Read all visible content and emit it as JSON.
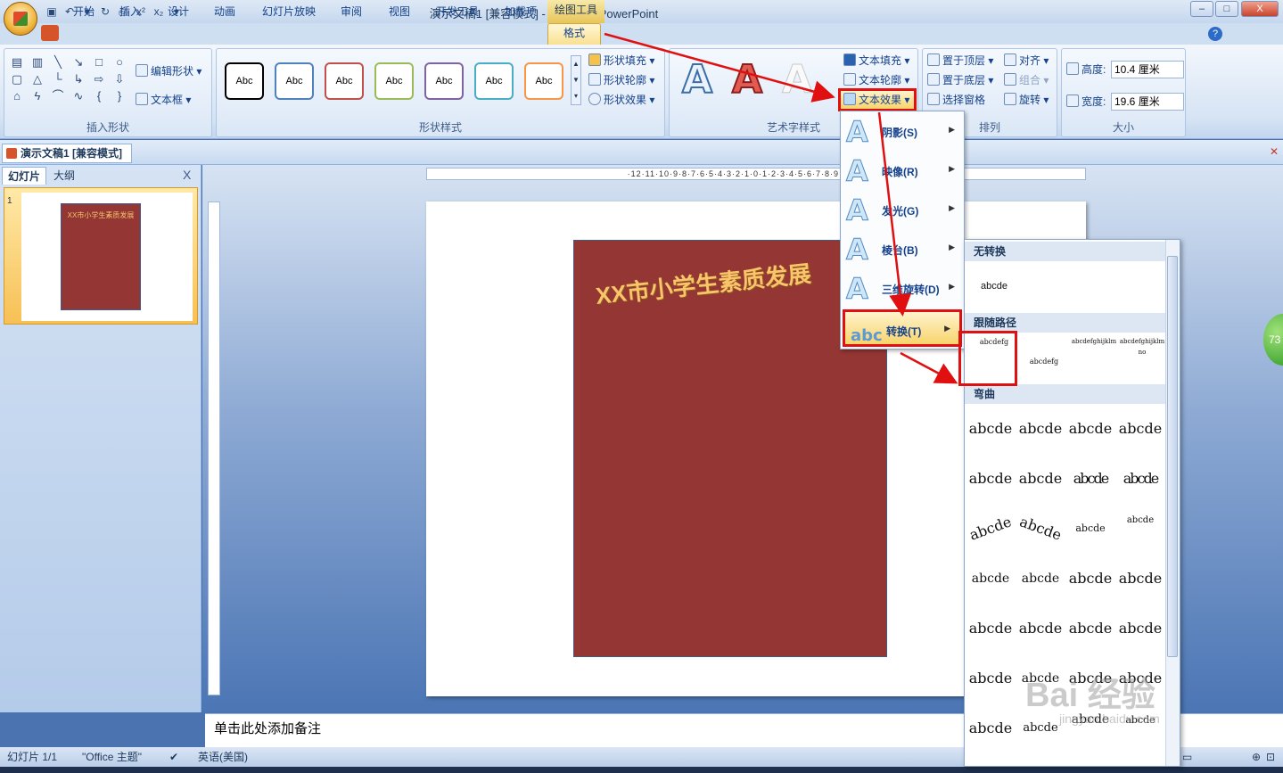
{
  "window": {
    "title": "演示文稿1 [兼容模式] - Microsoft PowerPoint",
    "context_tab_title": "绘图工具",
    "minimize_label": "–",
    "maximize_label": "□",
    "close_label": "X"
  },
  "tabs": [
    "开始",
    "插入",
    "设计",
    "动画",
    "幻灯片放映",
    "审阅",
    "视图",
    "开发工具",
    "加载项",
    "格式"
  ],
  "active_tab": "格式",
  "ribbon": {
    "insert_shapes": {
      "label": "插入形状",
      "edit_shape": "编辑形状",
      "textbox": "文本框"
    },
    "shape_styles": {
      "label": "形状样式",
      "preset_text": "Abc",
      "preset_colors": [
        "#000000",
        "#4f81bd",
        "#c0504d",
        "#9bbb59",
        "#8064a2",
        "#4bacc6",
        "#f79646"
      ],
      "fill": "形状填充",
      "outline": "形状轮廓",
      "effects": "形状效果"
    },
    "wordart_styles": {
      "label": "艺术字样式",
      "text_fill": "文本填充",
      "text_outline": "文本轮廓",
      "text_effects": "文本效果"
    },
    "arrange": {
      "label": "排列",
      "bring_front": "置于顶层",
      "send_back": "置于底层",
      "selection_pane": "选择窗格",
      "align": "对齐",
      "group": "组合",
      "rotate": "旋转"
    },
    "size": {
      "label": "大小",
      "height_label": "高度:",
      "height_value": "10.4 厘米",
      "width_label": "宽度:",
      "width_value": "19.6 厘米"
    }
  },
  "document_tab": "演示文稿1 [兼容模式]",
  "left_pane": {
    "tab_slides": "幻灯片",
    "tab_outline": "大纲",
    "close": "X",
    "slide_number": "1",
    "thumb_title": "XX市小学生素质发展"
  },
  "ruler_text": "·12·11·10·9·8·7·6·5·4·3·2·1·0·1·2·3·4·5·6·7·8·9·10·11·12·",
  "slide": {
    "title": "XX市小学生素质发展"
  },
  "text_effects_menu": [
    {
      "label": "阴影(S)"
    },
    {
      "label": "映像(R)"
    },
    {
      "label": "发光(G)"
    },
    {
      "label": "棱台(B)"
    },
    {
      "label": "三维旋转(D)"
    },
    {
      "label": "转换(T)"
    }
  ],
  "transform_gallery": {
    "no_transform_header": "无转换",
    "no_transform_sample": "abcde",
    "follow_path_header": "跟随路径",
    "follow_path_samples": [
      "abcdefg",
      "abcdefg",
      "abcdefghijklm",
      "abcdefghijklmno"
    ],
    "warp_header": "弯曲",
    "warp_sample": "abcde"
  },
  "notes_placeholder": "单击此处添加备注",
  "status": {
    "slide_count": "幻灯片 1/1",
    "theme": "\"Office 主题\"",
    "language": "英语(美国)"
  },
  "side_badge": "73",
  "watermark": "Bai 经验",
  "watermark_sub": "jingyan.baidu.com"
}
